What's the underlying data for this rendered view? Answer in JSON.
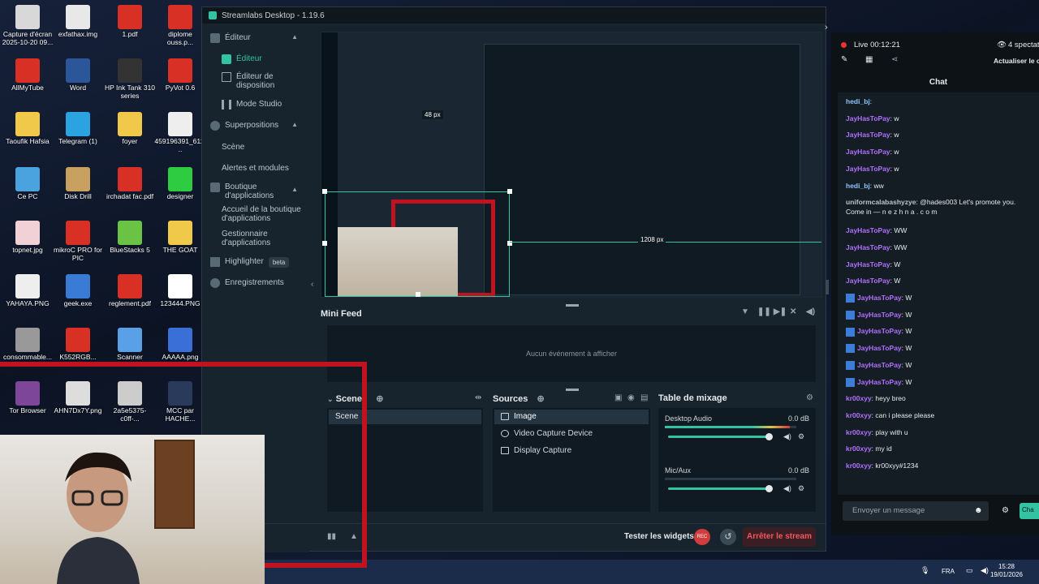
{
  "desktop_icons": [
    {
      "label": "Capture d'écran 2025-10-20 09...",
      "color": "#d8d8d8"
    },
    {
      "label": "exfathax.img",
      "color": "#e8e8e8"
    },
    {
      "label": "1.pdf",
      "color": "#d93025"
    },
    {
      "label": "diplome ouss.p...",
      "color": "#d93025"
    },
    {
      "label": "AllMyTube",
      "color": "#d93025"
    },
    {
      "label": "Word",
      "color": "#2b579a"
    },
    {
      "label": "HP Ink Tank 310 series",
      "color": "#333"
    },
    {
      "label": "PyVot 0.6",
      "color": "#d93025"
    },
    {
      "label": "Taoufik Hafsia",
      "color": "#f0c94b"
    },
    {
      "label": "Telegram (1)",
      "color": "#2aa3e0"
    },
    {
      "label": "foyer",
      "color": "#f0c94b"
    },
    {
      "label": "459196391_611...",
      "color": "#eee"
    },
    {
      "label": "Ce PC",
      "color": "#4aa3df"
    },
    {
      "label": "Disk Drill",
      "color": "#c8a060"
    },
    {
      "label": "irchadat fac.pdf",
      "color": "#d93025"
    },
    {
      "label": "designer",
      "color": "#2ecc40"
    },
    {
      "label": "topnet.jpg",
      "color": "#f1d0d6"
    },
    {
      "label": "mikroC PRO for PIC",
      "color": "#d93025"
    },
    {
      "label": "BlueStacks 5",
      "color": "#6ac345"
    },
    {
      "label": "THE GOAT",
      "color": "#f0c94b"
    },
    {
      "label": "YAHAYA.PNG",
      "color": "#eee"
    },
    {
      "label": "geek.exe",
      "color": "#3a7bd5"
    },
    {
      "label": "reglement.pdf",
      "color": "#d93025"
    },
    {
      "label": "123444.PNG",
      "color": "#fff"
    },
    {
      "label": "consommable...",
      "color": "#999"
    },
    {
      "label": "K552RGB...",
      "color": "#d93025"
    },
    {
      "label": "Scanner",
      "color": "#5aa0e6"
    },
    {
      "label": "AAAAA.png",
      "color": "#3a6fd8"
    },
    {
      "label": "Tor Browser",
      "color": "#7d4698"
    },
    {
      "label": "AHN7Dx7Y.png",
      "color": "#ddd"
    },
    {
      "label": "2a5e5375-c0ff-...",
      "color": "#ccc"
    },
    {
      "label": "MCC par HACHE...",
      "color": "#2a3a5a"
    }
  ],
  "window": {
    "title": "Streamlabs Desktop - 1.19.6"
  },
  "nav": {
    "editeur_header": "Éditeur",
    "editeur": "Éditeur",
    "editeur_disposition": "Éditeur de disposition",
    "mode_studio": "Mode Studio",
    "superpositions": "Superpositions",
    "scene": "Scène",
    "alertes": "Alertes et modules",
    "boutique": "Boutique d'applications",
    "accueil_boutique": "Accueil de la boutique d'applications",
    "gestionnaire": "Gestionnaire d'applications",
    "highlighter": "Highlighter",
    "beta": "beta",
    "enregistrements": "Enregistrements"
  },
  "preview": {
    "dim_label": "1208 px",
    "dim_label2": "48 px"
  },
  "mini_feed": {
    "title": "Mini Feed",
    "empty": "Aucun événement à afficher"
  },
  "scenes": {
    "title": "Scenes",
    "items": [
      "Scene"
    ]
  },
  "sources": {
    "title": "Sources",
    "items": [
      "Image",
      "Video Capture Device",
      "Display Capture"
    ]
  },
  "mixer": {
    "title": "Table de mixage",
    "channels": [
      {
        "name": "Desktop Audio",
        "db": "0.0 dB",
        "level": 0.95
      },
      {
        "name": "Mic/Aux",
        "db": "0.0 dB",
        "level": 0.0
      }
    ]
  },
  "footer": {
    "test_widgets": "Tester les widgets",
    "rec": "REC",
    "stop": "Arrêter le stream"
  },
  "live": {
    "status": "Live 00:12:21",
    "viewers": "4 spectat",
    "refresh": "Actualiser le c"
  },
  "chat": {
    "title": "Chat",
    "input_placeholder": "Envoyer un message",
    "send": "Cha",
    "messages": [
      {
        "user": "hedi_bj",
        "text": "",
        "color": "#8ec5ff",
        "badge": false
      },
      {
        "user": "JayHasToPay",
        "text": "w",
        "color": "#b070ff",
        "badge": false
      },
      {
        "user": "JayHasToPay",
        "text": "w",
        "color": "#b070ff",
        "badge": false
      },
      {
        "user": "JayHasToPay",
        "text": "w",
        "color": "#b070ff",
        "badge": false
      },
      {
        "user": "JayHasToPay",
        "text": "w",
        "color": "#b070ff",
        "badge": false
      },
      {
        "user": "hedi_bj",
        "text": "ww",
        "color": "#8ec5ff",
        "badge": false
      },
      {
        "user": "uniformcalabashyzye",
        "text": "@hades003 Let's promote you. Come in — n e z h n a . c o m",
        "color": "#b9c4cc",
        "badge": false
      },
      {
        "user": "JayHasToPay",
        "text": "WW",
        "color": "#b070ff",
        "badge": false
      },
      {
        "user": "JayHasToPay",
        "text": "WW",
        "color": "#b070ff",
        "badge": false
      },
      {
        "user": "JayHasToPay",
        "text": "W",
        "color": "#b070ff",
        "badge": false
      },
      {
        "user": "JayHasToPay",
        "text": "W",
        "color": "#b070ff",
        "badge": false
      },
      {
        "user": "JayHasToPay",
        "text": "W",
        "color": "#b070ff",
        "badge": true
      },
      {
        "user": "JayHasToPay",
        "text": "W",
        "color": "#b070ff",
        "badge": true
      },
      {
        "user": "JayHasToPay",
        "text": "W",
        "color": "#b070ff",
        "badge": true
      },
      {
        "user": "JayHasToPay",
        "text": "W",
        "color": "#b070ff",
        "badge": true
      },
      {
        "user": "JayHasToPay",
        "text": "W",
        "color": "#b070ff",
        "badge": true
      },
      {
        "user": "JayHasToPay",
        "text": "W",
        "color": "#b070ff",
        "badge": true
      },
      {
        "user": "kr00xyy",
        "text": "heyy breo",
        "color": "#b070ff",
        "badge": false
      },
      {
        "user": "kr00xyy",
        "text": "can i please please",
        "color": "#b070ff",
        "badge": false
      },
      {
        "user": "kr00xyy",
        "text": "play with u",
        "color": "#b070ff",
        "badge": false
      },
      {
        "user": "kr00xyy",
        "text": "my id",
        "color": "#b070ff",
        "badge": false
      },
      {
        "user": "kr00xyy",
        "text": "kr00xyy#1234",
        "color": "#b070ff",
        "badge": false
      }
    ]
  },
  "taskbar": {
    "lang": "FRA",
    "time": "15:28",
    "date": "19/01/2026"
  },
  "accent": "#31c3a2"
}
